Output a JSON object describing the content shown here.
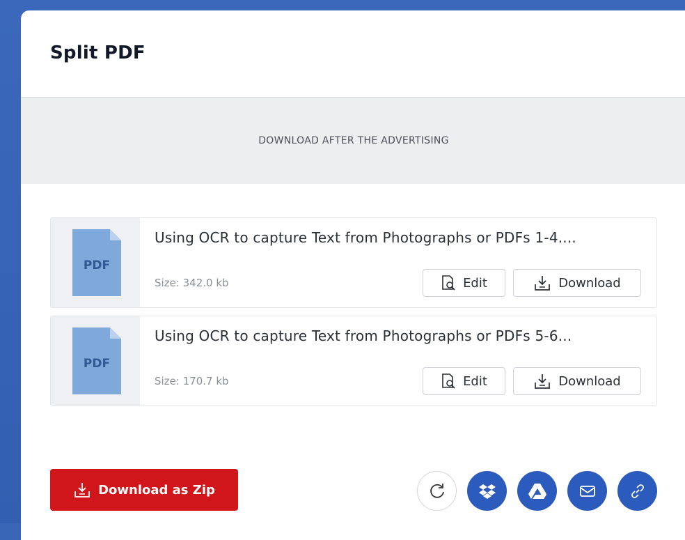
{
  "page": {
    "title": "Split PDF"
  },
  "ad": {
    "text": "DOWNLOAD AFTER THE ADVERTISING"
  },
  "files": [
    {
      "icon_label": "PDF",
      "name": "Using OCR to capture Text from Photographs or PDFs 1-4....",
      "size": "Size: 342.0 kb",
      "edit_label": "Edit",
      "download_label": "Download"
    },
    {
      "icon_label": "PDF",
      "name": "Using OCR to capture Text from Photographs or PDFs 5-6...",
      "size": "Size: 170.7 kb",
      "edit_label": "Edit",
      "download_label": "Download"
    }
  ],
  "actions": {
    "zip_label": "Download as Zip",
    "share_icons": [
      "refresh-icon",
      "dropbox-icon",
      "google-drive-icon",
      "mail-icon",
      "link-icon"
    ]
  },
  "colors": {
    "accent_red": "#d0161b",
    "accent_blue": "#2a5bbd",
    "pdf_icon_blue": "#7fa9db"
  }
}
